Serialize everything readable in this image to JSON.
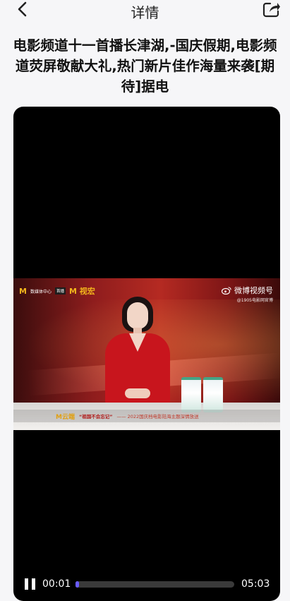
{
  "nav": {
    "title": "详情",
    "back_icon": "chevron-left-icon",
    "share_icon": "share-icon"
  },
  "article": {
    "title": "电影频道十一首播长津湖,-国庆假期,电影频道荧屏敬献大礼,热门新片佳作海量来袭[期待]据电"
  },
  "video": {
    "overlay": {
      "left_logo_text": "数媒体中心",
      "left_badge": "首播",
      "left_brand": "M 视宏",
      "watermark_title": "微博视频号",
      "watermark_sub": "@1905电影网官博",
      "ticker_brand": "M云端",
      "ticker_quote": "“祖国不会忘记”",
      "ticker_text": "—— 2022国庆档电影陆海主题深情放送"
    },
    "controls": {
      "current_time": "00:01",
      "duration": "05:03",
      "progress": 0.02,
      "accent_color": "#6a5cff"
    }
  }
}
